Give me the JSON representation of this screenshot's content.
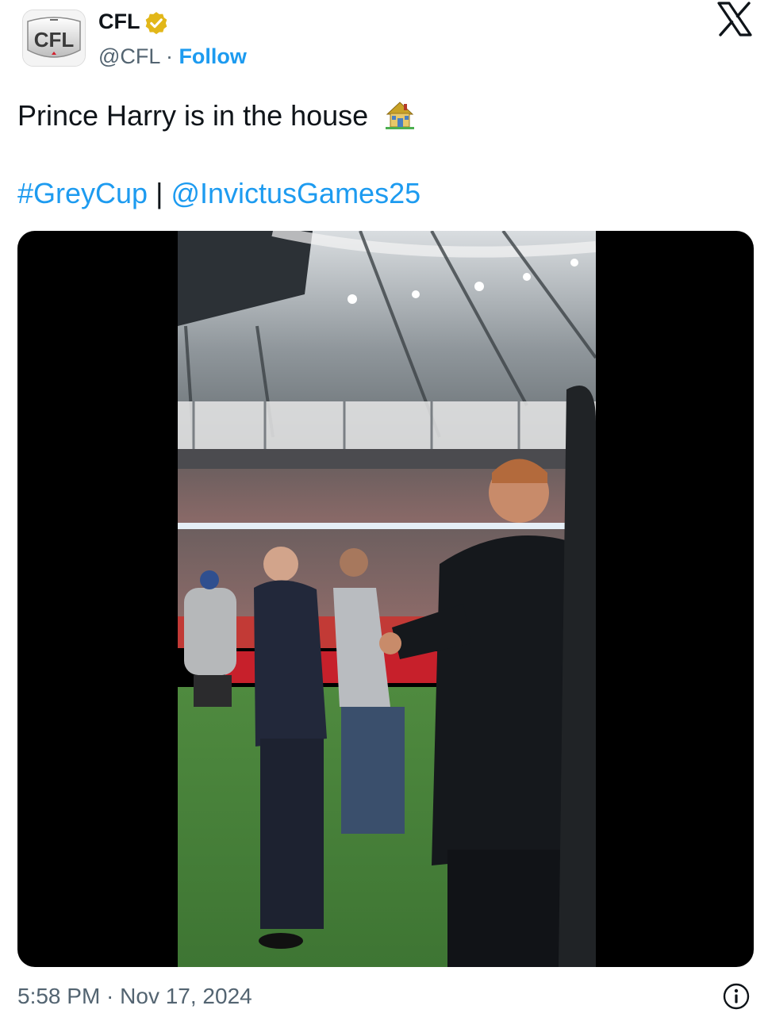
{
  "author": {
    "name": "CFL",
    "handle": "@CFL",
    "separator": "·",
    "follow_label": "Follow",
    "avatar_text": "CFL",
    "verified_color": "#e2b719"
  },
  "tweet": {
    "text": "Prince Harry is in the house",
    "emoji": "house-emoji",
    "hashtag": "#GreyCup",
    "divider": "|",
    "mention": "@InvictusGames25"
  },
  "media": {
    "type": "video",
    "description_icon": "video-player"
  },
  "footer": {
    "timestamp": "5:58 PM · Nov 17, 2024",
    "info_icon": "info-icon"
  },
  "colors": {
    "link": "#1d9bf0",
    "secondary_text": "#536471",
    "primary_text": "#0f1419"
  }
}
